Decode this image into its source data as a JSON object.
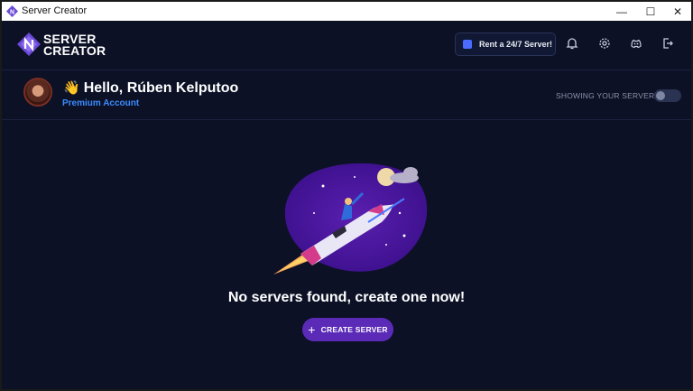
{
  "window": {
    "title": "Server Creator",
    "minimize": "—",
    "maximize": "☐",
    "close": "✕"
  },
  "header": {
    "logo_line1": "SERVER",
    "logo_line2": "CREATOR",
    "rent_button": "Rent a 24/7 Server!",
    "icons": [
      "bell-icon",
      "gear-icon",
      "discord-icon",
      "logout-icon"
    ]
  },
  "welcome": {
    "wave": "👋",
    "greeting": "Hello, Rúben Kelputoo",
    "account_type": "Premium Account",
    "showing_label": "SHOWING YOUR SERVERS",
    "showing_toggle_on": false
  },
  "empty_state": {
    "message": "No servers found, create one now!",
    "create_label": "CREATE SERVER",
    "create_plus": "+"
  },
  "colors": {
    "background": "#0c1126",
    "accent": "#5b2bb8",
    "link": "#3b8cff"
  }
}
